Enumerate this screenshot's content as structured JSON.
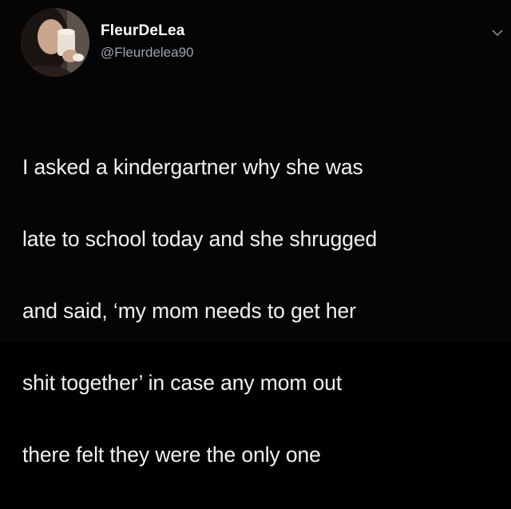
{
  "tweet": {
    "author": {
      "display_name": "FleurDeLea",
      "handle": "@Fleurdelea90",
      "avatar_icon": "profile-photo-avatar"
    },
    "menu_icon": "chevron-down-icon",
    "text_lines": [
      "I asked a kindergartner why she was",
      "late to school today and she shrugged",
      "and said, ‘my mom needs to get her",
      "shit together’ in case any mom out",
      "there felt they were the only one"
    ]
  },
  "colors": {
    "background": "#000000",
    "name_text": "#ffffff",
    "handle_text": "#9aa3ab",
    "body_text": "#f2f2f2"
  }
}
